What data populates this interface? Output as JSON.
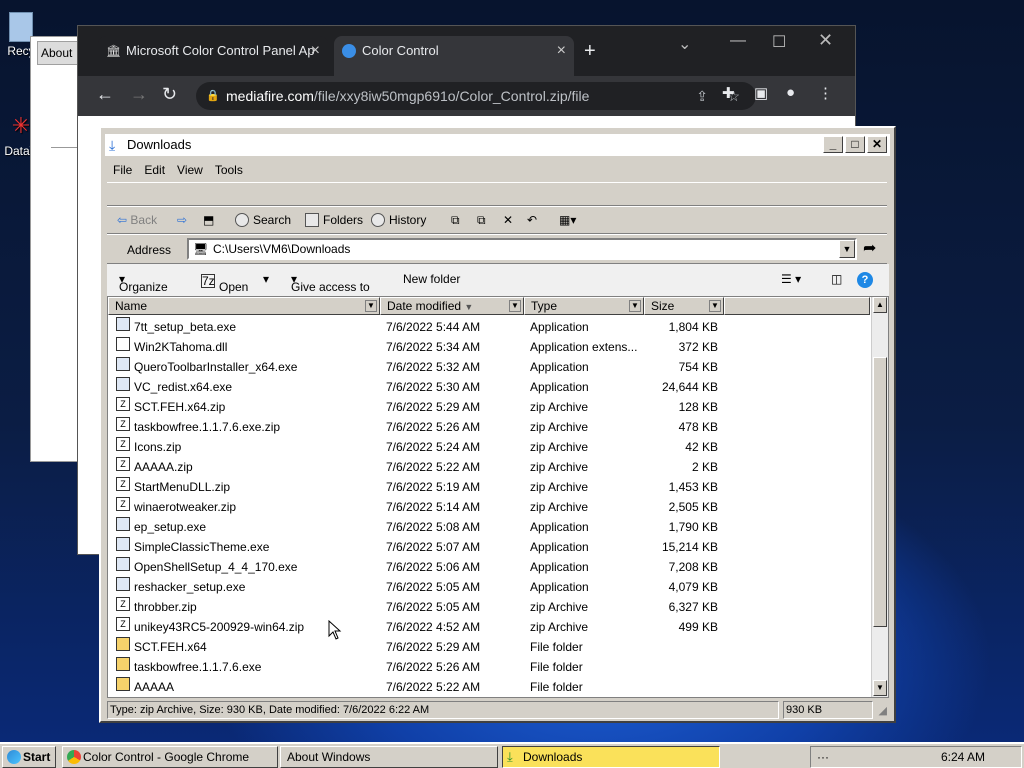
{
  "desktop": {
    "icons": [
      {
        "label": "Recy"
      },
      {
        "label": "DataV"
      }
    ]
  },
  "about_window": {
    "tab_label": "About"
  },
  "chrome": {
    "tabs": [
      {
        "label": "Microsoft Color Control Panel Ap"
      },
      {
        "label": "Color Control"
      }
    ],
    "url_host": "mediafire.com",
    "url_path": "/file/xxy8iw50mgp691o/Color_Control.zip/file"
  },
  "explorer": {
    "title": "Downloads",
    "menu": [
      "File",
      "Edit",
      "View",
      "Tools"
    ],
    "toolbar": {
      "back": "Back",
      "search": "Search",
      "folders": "Folders",
      "history": "History"
    },
    "address_label": "Address",
    "address_value": "C:\\Users\\VM6\\Downloads",
    "commands": {
      "organize": "Organize",
      "open": "Open",
      "give_access": "Give access to",
      "new_folder": "New folder"
    },
    "columns": {
      "name": "Name",
      "date": "Date modified",
      "type": "Type",
      "size": "Size"
    },
    "files": [
      {
        "name": "7tt_setup_beta.exe",
        "date": "7/6/2022 5:44 AM",
        "type": "Application",
        "size": "1,804 KB"
      },
      {
        "name": "Win2KTahoma.dll",
        "date": "7/6/2022 5:34 AM",
        "type": "Application extens...",
        "size": "372 KB"
      },
      {
        "name": "QueroToolbarInstaller_x64.exe",
        "date": "7/6/2022 5:32 AM",
        "type": "Application",
        "size": "754 KB"
      },
      {
        "name": "VC_redist.x64.exe",
        "date": "7/6/2022 5:30 AM",
        "type": "Application",
        "size": "24,644 KB"
      },
      {
        "name": "SCT.FEH.x64.zip",
        "date": "7/6/2022 5:29 AM",
        "type": "zip Archive",
        "size": "128 KB"
      },
      {
        "name": "taskbowfree.1.1.7.6.exe.zip",
        "date": "7/6/2022 5:26 AM",
        "type": "zip Archive",
        "size": "478 KB"
      },
      {
        "name": "Icons.zip",
        "date": "7/6/2022 5:24 AM",
        "type": "zip Archive",
        "size": "42 KB"
      },
      {
        "name": "AAAAA.zip",
        "date": "7/6/2022 5:22 AM",
        "type": "zip Archive",
        "size": "2 KB"
      },
      {
        "name": "StartMenuDLL.zip",
        "date": "7/6/2022 5:19 AM",
        "type": "zip Archive",
        "size": "1,453 KB"
      },
      {
        "name": "winaerotweaker.zip",
        "date": "7/6/2022 5:14 AM",
        "type": "zip Archive",
        "size": "2,505 KB"
      },
      {
        "name": "ep_setup.exe",
        "date": "7/6/2022 5:08 AM",
        "type": "Application",
        "size": "1,790 KB"
      },
      {
        "name": "SimpleClassicTheme.exe",
        "date": "7/6/2022 5:07 AM",
        "type": "Application",
        "size": "15,214 KB"
      },
      {
        "name": "OpenShellSetup_4_4_170.exe",
        "date": "7/6/2022 5:06 AM",
        "type": "Application",
        "size": "7,208 KB"
      },
      {
        "name": "reshacker_setup.exe",
        "date": "7/6/2022 5:05 AM",
        "type": "Application",
        "size": "4,079 KB"
      },
      {
        "name": "throbber.zip",
        "date": "7/6/2022 5:05 AM",
        "type": "zip Archive",
        "size": "6,327 KB"
      },
      {
        "name": "unikey43RC5-200929-win64.zip",
        "date": "7/6/2022 4:52 AM",
        "type": "zip Archive",
        "size": "499 KB"
      },
      {
        "name": "SCT.FEH.x64",
        "date": "7/6/2022 5:29 AM",
        "type": "File folder",
        "size": ""
      },
      {
        "name": "taskbowfree.1.1.7.6.exe",
        "date": "7/6/2022 5:26 AM",
        "type": "File folder",
        "size": ""
      },
      {
        "name": "AAAAA",
        "date": "7/6/2022 5:22 AM",
        "type": "File folder",
        "size": ""
      }
    ],
    "status_left": "Type: zip Archive, Size: 930 KB, Date modified: 7/6/2022 6:22 AM",
    "status_right": "930 KB"
  },
  "taskbar": {
    "start": "Start",
    "tasks": [
      "Color Control - Google Chrome",
      "About Windows",
      "Downloads"
    ],
    "tray_dots": "···",
    "clock": "6:24 AM"
  }
}
